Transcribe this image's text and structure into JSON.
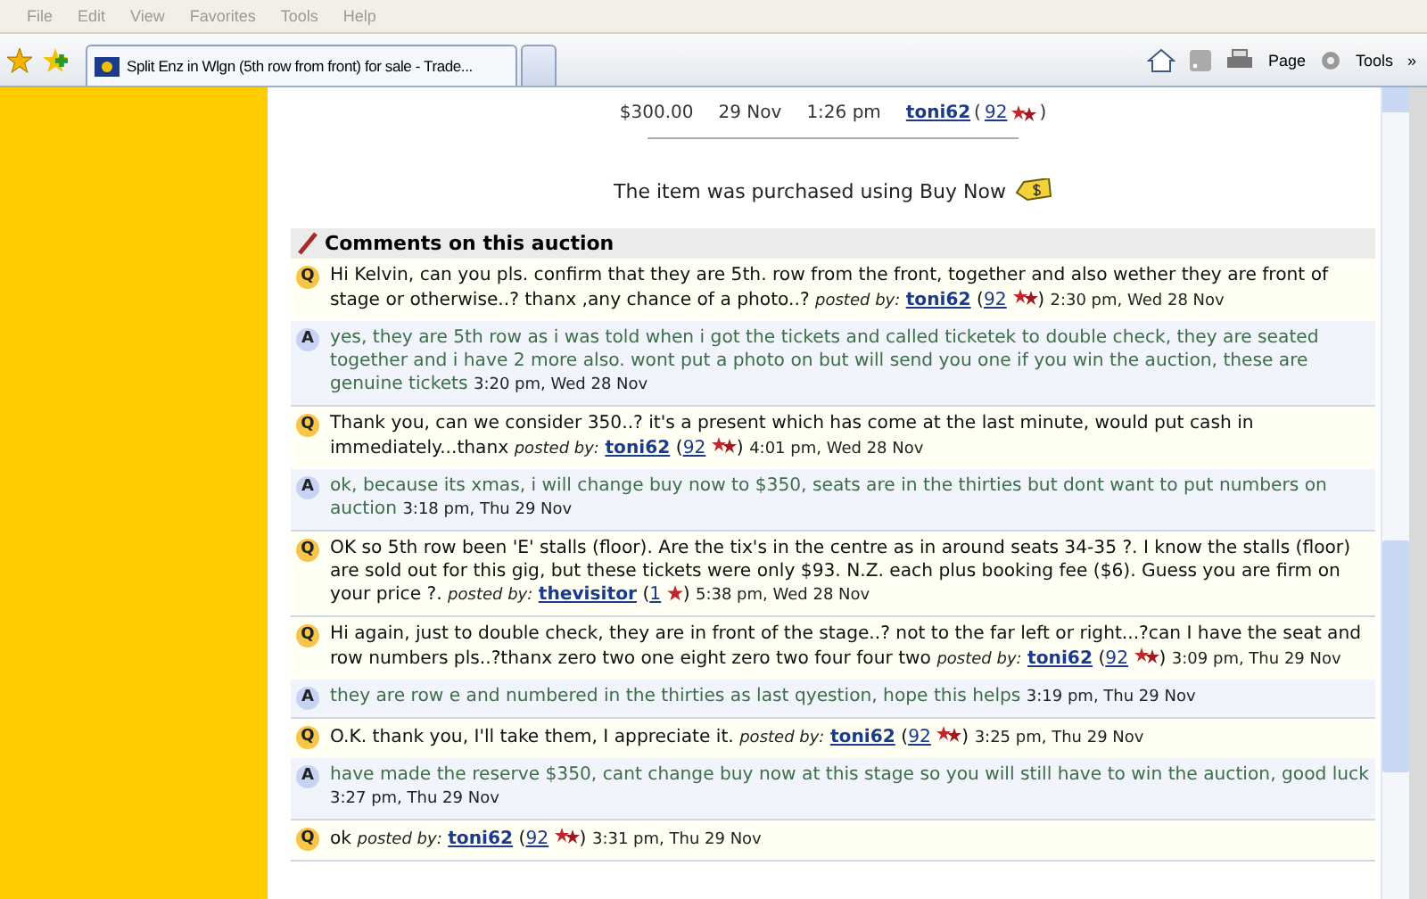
{
  "menu": [
    "File",
    "Edit",
    "View",
    "Favorites",
    "Tools",
    "Help"
  ],
  "tabs": [
    {
      "label": "Split Enz in Wlgn (5th row from front) for sale - Trade...",
      "selected": true
    },
    {
      "selected": false
    }
  ],
  "toolbar": {
    "page": "Page",
    "tools": "Tools",
    "more": "»"
  },
  "bid_row": {
    "amount": "$300.00",
    "date": "29 Nov",
    "time": "1:26 pm",
    "user": "toni62",
    "open": "(",
    "rating": "92",
    "close": ")"
  },
  "buy_now": "The item was purchased using Buy Now",
  "rating_open": "(",
  "rating_close": ")",
  "comments": {
    "title": "Comments on this auction",
    "items": [
      {
        "kind": "question",
        "badge": "Q",
        "text": "Hi Kelvin, can you pls. confirm that they are 5th. row from the front, together and also wether they are front of stage or otherwise..? thanx ,any chance of a photo..?",
        "posted": "posted by:",
        "user": "toni62",
        "rating": "92",
        "single_star": false,
        "time": "2:30 pm, Wed 28 Nov"
      },
      {
        "kind": "answer",
        "badge": "A",
        "text": "yes, they are 5th row as i was told when i got the tickets and called ticketek to double check, they are seated together and i have 2 more also. wont put a photo on but will send you one if you win the auction, these are genuine tickets",
        "time": "3:20 pm, Wed 28 Nov"
      },
      {
        "kind": "question",
        "badge": "Q",
        "text": "Thank you, can we consider 350..? it's a present which has come at the last minute, would put cash in immediately...thanx",
        "posted": "posted by:",
        "user": "toni62",
        "rating": "92",
        "single_star": false,
        "time": "4:01 pm, Wed 28 Nov"
      },
      {
        "kind": "answer",
        "badge": "A",
        "text": "ok, because its xmas, i will change buy now to $350, seats are in the thirties but dont want to put numbers on auction",
        "time": "3:18 pm, Thu 29 Nov"
      },
      {
        "kind": "question",
        "badge": "Q",
        "text": "OK so 5th row been 'E' stalls (floor). Are the tix's in the centre as in around seats 34-35 ?. I know the stalls (floor) are sold out for this gig, but these tickets were only $93. N.Z. each plus booking fee ($6). Guess you are firm on your price ?.",
        "posted": "posted by:",
        "user": "thevisitor",
        "rating": "1",
        "single_star": true,
        "time": "5:38 pm, Wed 28 Nov"
      },
      {
        "kind": "question",
        "badge": "Q",
        "text": "Hi again, just to double check, they are in front of the stage..? not to the far left or right...?can I have the seat and row numbers pls..?thanx zero two one eight zero two four four two",
        "posted": "posted by:",
        "user": "toni62",
        "rating": "92",
        "single_star": false,
        "time": "3:09 pm, Thu 29 Nov"
      },
      {
        "kind": "answer",
        "badge": "A",
        "text": "they are row e and numbered in the thirties as last qyestion, hope this helps",
        "time": "3:19 pm, Thu 29 Nov"
      },
      {
        "kind": "question",
        "badge": "Q",
        "text": "O.K. thank you, I'll take them, I appreciate it.",
        "posted": "posted by:",
        "user": "toni62",
        "rating": "92",
        "single_star": false,
        "time": "3:25 pm, Thu 29 Nov"
      },
      {
        "kind": "answer",
        "badge": "A",
        "text": "have made the reserve $350, cant change buy now at this stage so you will still have to win the auction, good luck",
        "time": "3:27 pm, Thu 29 Nov"
      },
      {
        "kind": "question",
        "badge": "Q",
        "text": "ok",
        "posted": "posted by:",
        "user": "toni62",
        "rating": "92",
        "single_star": false,
        "time": "3:31 pm, Thu 29 Nov"
      }
    ]
  }
}
